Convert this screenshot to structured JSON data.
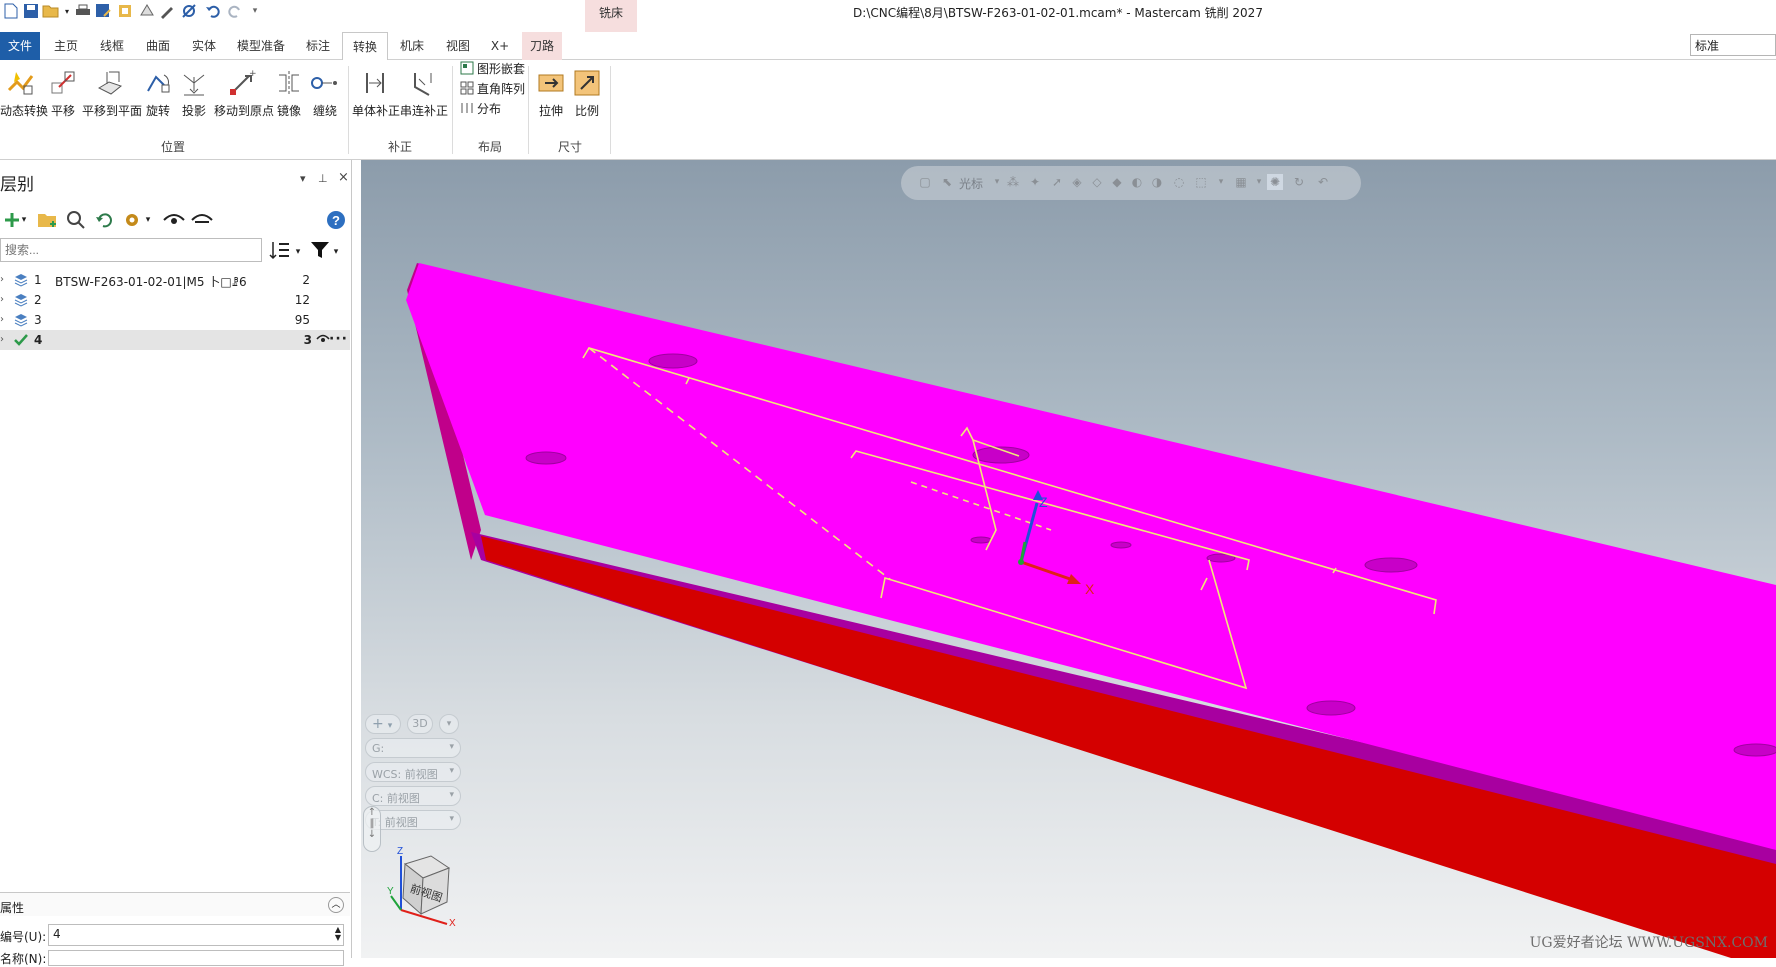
{
  "title_bar": {
    "window_title": "D:\\CNC编程\\8月\\BTSW-F263-01-02-01.mcam* - Mastercam 铣削 2027",
    "context_tab_group": "铣床",
    "quick_access_icons": [
      "new-file-icon",
      "save-icon",
      "open-icon",
      "print-icon",
      "save-as-icon",
      "load-icon",
      "convert-icon",
      "edit-icon",
      "settings-icon",
      "undo-icon",
      "redo-icon",
      "customize-icon"
    ]
  },
  "ribbon": {
    "tabs": [
      {
        "label": "文件"
      },
      {
        "label": "主页"
      },
      {
        "label": "线框"
      },
      {
        "label": "曲面"
      },
      {
        "label": "实体"
      },
      {
        "label": "模型准备"
      },
      {
        "label": "标注"
      },
      {
        "label": "转换"
      },
      {
        "label": "机床"
      },
      {
        "label": "视图"
      },
      {
        "label": "X+"
      },
      {
        "label": "刀路"
      }
    ],
    "active_tab": "转换",
    "style_select": "标准",
    "position_group": {
      "label": "位置",
      "buttons": [
        "动态转换",
        "平移",
        "平移到平面",
        "旋转",
        "投影",
        "移动到原点",
        "镜像",
        "缠绕"
      ]
    },
    "offset_group": {
      "label": "补正",
      "buttons": [
        "单体补正",
        "串连补正"
      ]
    },
    "layout_group": {
      "label": "布局",
      "buttons": [
        "图形嵌套",
        "直角阵列",
        "分布"
      ]
    },
    "size_group": {
      "label": "尺寸",
      "buttons": [
        "拉伸",
        "比例"
      ]
    }
  },
  "layers_panel": {
    "title": "层别",
    "pin": "📌",
    "close": "×",
    "search_placeholder": "搜索...",
    "layers": [
      {
        "number": "1",
        "name": "BTSW-F263-01-02-01|M5 卜□ꗗ6",
        "count": "2"
      },
      {
        "number": "2",
        "name": "",
        "count": "12"
      },
      {
        "number": "3",
        "name": "",
        "count": "95"
      },
      {
        "number": "4",
        "name": "",
        "count": "3",
        "active": true
      }
    ],
    "properties": {
      "title": "属性",
      "number_label": "编号(U):",
      "number_value": "4",
      "name_label": "名称(N):"
    }
  },
  "viewport": {
    "toolbar_label": "光标",
    "add_label": "+",
    "view_3d": "3D",
    "g_label": "G:",
    "wcs_label": "WCS: 前视图",
    "c_label": "C: 前视图",
    "t_label": "T: 前视图",
    "cube_face_label": "前视图",
    "axis_labels": {
      "x": "X",
      "y": "Y",
      "z": "Z"
    },
    "watermark": "UG爱好者论坛 WWW.UGSNX.COM",
    "colors": {
      "plate_top": "#ff00ff",
      "plate_side": "#b3009b",
      "plate_bottom": "#d40000",
      "geometry": "#f0e878",
      "axis_x": "#e0201a",
      "axis_y": "#1fa33a",
      "axis_z": "#2050d8"
    }
  }
}
